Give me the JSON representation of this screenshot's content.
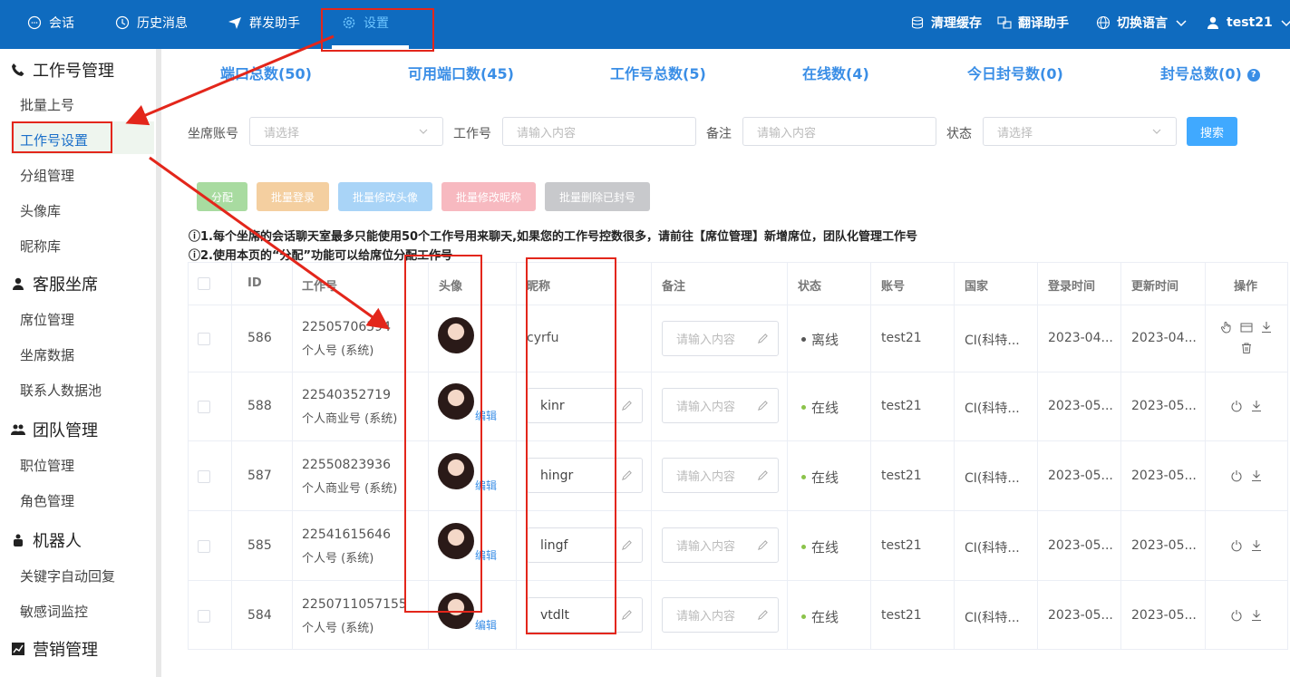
{
  "topnav": {
    "items": [
      {
        "label": "会话",
        "icon": "chat-icon"
      },
      {
        "label": "历史消息",
        "icon": "clock-icon"
      },
      {
        "label": "群发助手",
        "icon": "send-icon"
      },
      {
        "label": "设置",
        "icon": "gear-icon",
        "active": true
      }
    ],
    "right": {
      "clear_cache": "清理缓存",
      "translate": "翻译助手",
      "language": "切换语言",
      "user": "test21"
    }
  },
  "sidebar": {
    "groups": [
      {
        "label": "工作号管理",
        "icon": "phone-icon",
        "items": [
          "批量上号",
          "工作号设置",
          "分组管理",
          "头像库",
          "昵称库"
        ]
      },
      {
        "label": "客服坐席",
        "icon": "person-icon",
        "items": [
          "席位管理",
          "坐席数据",
          "联系人数据池"
        ]
      },
      {
        "label": "团队管理",
        "icon": "team-icon",
        "items": [
          "职位管理",
          "角色管理"
        ]
      },
      {
        "label": "机器人",
        "icon": "robot-icon",
        "items": [
          "关键字自动回复",
          "敏感词监控"
        ]
      },
      {
        "label": "营销管理",
        "icon": "chart-icon",
        "items": []
      }
    ],
    "active_item": "工作号设置"
  },
  "stats": [
    "端口总数(50)",
    "可用端口数(45)",
    "工作号总数(5)",
    "在线数(4)",
    "今日封号数(0)",
    "封号总数(0)"
  ],
  "filters": {
    "seat_label": "坐席账号",
    "seat_placeholder": "请选择",
    "work_no_label": "工作号",
    "work_no_placeholder": "请输入内容",
    "remark_label": "备注",
    "remark_placeholder": "请输入内容",
    "status_label": "状态",
    "status_placeholder": "请选择",
    "search_button": "搜索"
  },
  "actions": [
    {
      "label": "分配",
      "color": "#a8dba0"
    },
    {
      "label": "批量登录",
      "color": "#f4cfa0"
    },
    {
      "label": "批量修改头像",
      "color": "#a9d4f7"
    },
    {
      "label": "批量修改昵称",
      "color": "#f7b9c0"
    },
    {
      "label": "批量删除已封号",
      "color": "#c8c9cc"
    }
  ],
  "notices": [
    "ⓘ1.每个坐席的会话聊天室最多只能使用50个工作号用来聊天,如果您的工作号控数很多，请前往【席位管理】新增席位，团队化管理工作号",
    "ⓘ2.使用本页的“分配”功能可以给席位分配工作号"
  ],
  "table": {
    "headers": [
      "ID",
      "工作号",
      "头像",
      "昵称",
      "备注",
      "状态",
      "账号",
      "国家",
      "登录时间",
      "更新时间",
      "操作"
    ],
    "edit_label": "编辑",
    "remark_placeholder": "请输入内容",
    "rows": [
      {
        "id": "586",
        "number": "22505706594",
        "type": "个人号 (系统)",
        "nickname": "cyrfu",
        "status": "离线",
        "account": "test21",
        "country": "CI(科特...",
        "login": "2023-04...",
        "update": "2023-04..."
      },
      {
        "id": "588",
        "number": "22540352719",
        "type": "个人商业号 (系统)",
        "nickname": "kinr",
        "status": "在线",
        "account": "test21",
        "country": "CI(科特...",
        "login": "2023-05...",
        "update": "2023-05..."
      },
      {
        "id": "587",
        "number": "22550823936",
        "type": "个人商业号 (系统)",
        "nickname": "hingr",
        "status": "在线",
        "account": "test21",
        "country": "CI(科特...",
        "login": "2023-05...",
        "update": "2023-05..."
      },
      {
        "id": "585",
        "number": "22541615646",
        "type": "个人号 (系统)",
        "nickname": "lingf",
        "status": "在线",
        "account": "test21",
        "country": "CI(科特...",
        "login": "2023-05...",
        "update": "2023-05..."
      },
      {
        "id": "584",
        "number": "2250711057155",
        "type": "个人号 (系统)",
        "nickname": "vtdlt",
        "status": "在线",
        "account": "test21",
        "country": "CI(科特...",
        "login": "2023-05...",
        "update": "2023-05..."
      }
    ]
  },
  "colors": {
    "topbar": "#0f6bbf",
    "accent": "#3a8ee6",
    "online": "#8bc34a",
    "offline": "#555555",
    "annotation": "#e3261b"
  }
}
